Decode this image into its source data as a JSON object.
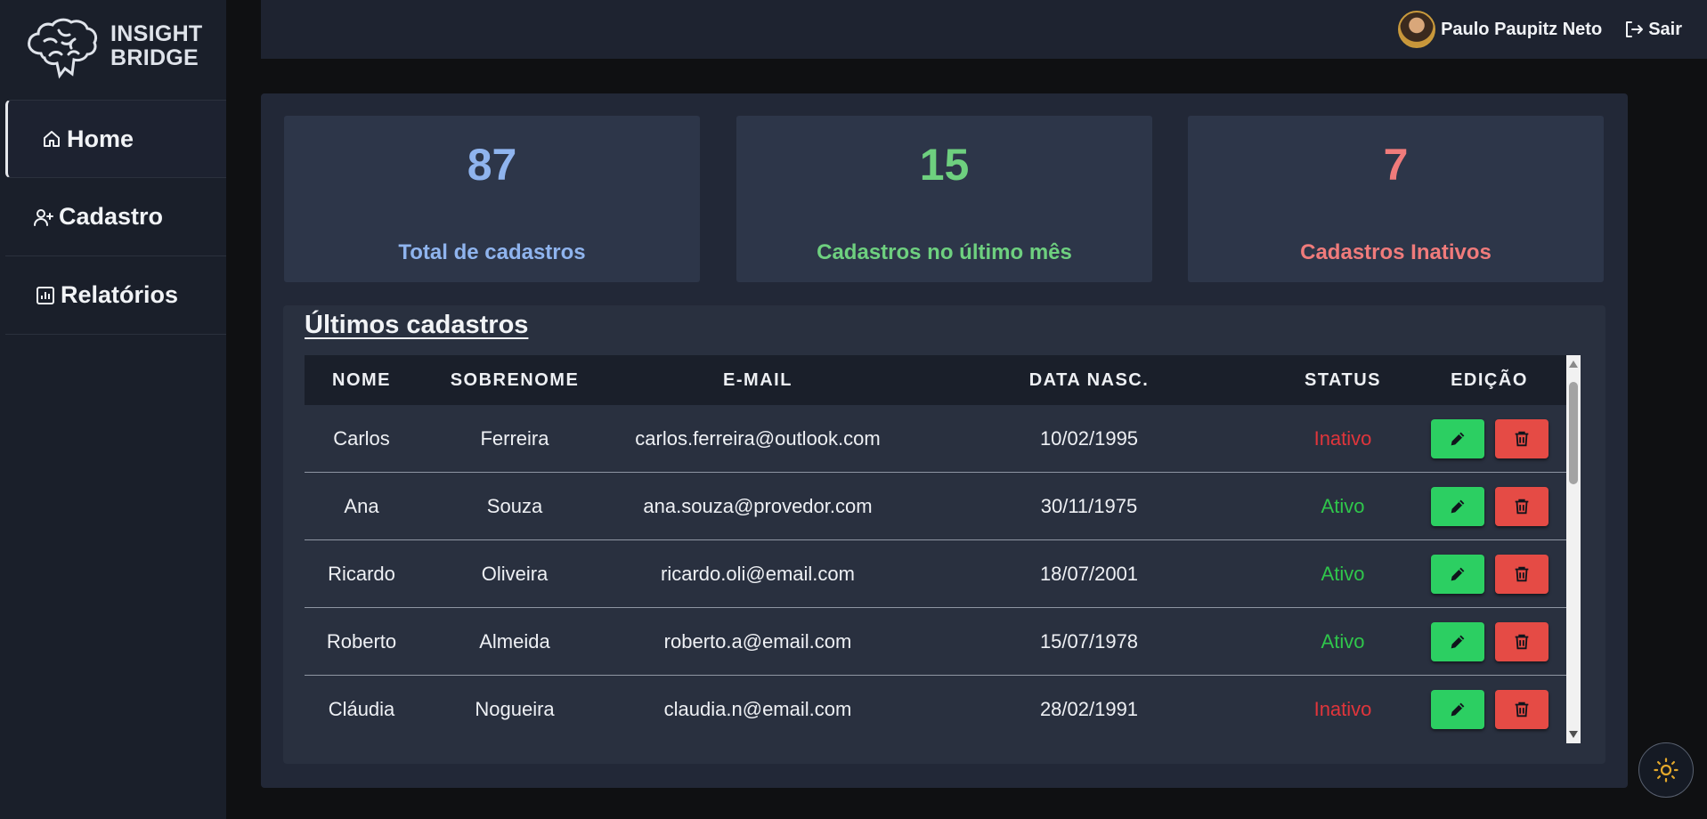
{
  "brand": {
    "line1": "INSIGHT",
    "line2": "BRIDGE"
  },
  "sidebar": {
    "items": [
      {
        "label": "Home",
        "icon": "home-icon",
        "active": true
      },
      {
        "label": "Cadastro",
        "icon": "user-plus-icon",
        "active": false
      },
      {
        "label": "Relatórios",
        "icon": "report-icon",
        "active": false
      }
    ]
  },
  "header": {
    "user_name": "Paulo Paupitz Neto",
    "logout_label": "Sair"
  },
  "stats": [
    {
      "value": "87",
      "label": "Total de cadastros",
      "color": "#8fb4ee"
    },
    {
      "value": "15",
      "label": "Cadastros no último mês",
      "color": "#6ed07f"
    },
    {
      "value": "7",
      "label": "Cadastros Inativos",
      "color": "#f07b7b"
    }
  ],
  "table": {
    "title": "Últimos cadastros",
    "columns": [
      "NOME",
      "SOBRENOME",
      "E-MAIL",
      "DATA NASC.",
      "STATUS",
      "EDIÇÃO"
    ],
    "rows": [
      {
        "nome": "Carlos",
        "sobrenome": "Ferreira",
        "email": "carlos.ferreira@outlook.com",
        "data": "10/02/1995",
        "status": "Inativo"
      },
      {
        "nome": "Ana",
        "sobrenome": "Souza",
        "email": "ana.souza@provedor.com",
        "data": "30/11/1975",
        "status": "Ativo"
      },
      {
        "nome": "Ricardo",
        "sobrenome": "Oliveira",
        "email": "ricardo.oli@email.com",
        "data": "18/07/2001",
        "status": "Ativo"
      },
      {
        "nome": "Roberto",
        "sobrenome": "Almeida",
        "email": "roberto.a@email.com",
        "data": "15/07/1978",
        "status": "Ativo"
      },
      {
        "nome": "Cláudia",
        "sobrenome": "Nogueira",
        "email": "claudia.n@email.com",
        "data": "28/02/1991",
        "status": "Inativo"
      }
    ]
  },
  "colors": {
    "ativo": "#2fc64b",
    "inativo": "#e0353b",
    "edit_button": "#2ccf62",
    "delete_button": "#e54b45"
  }
}
